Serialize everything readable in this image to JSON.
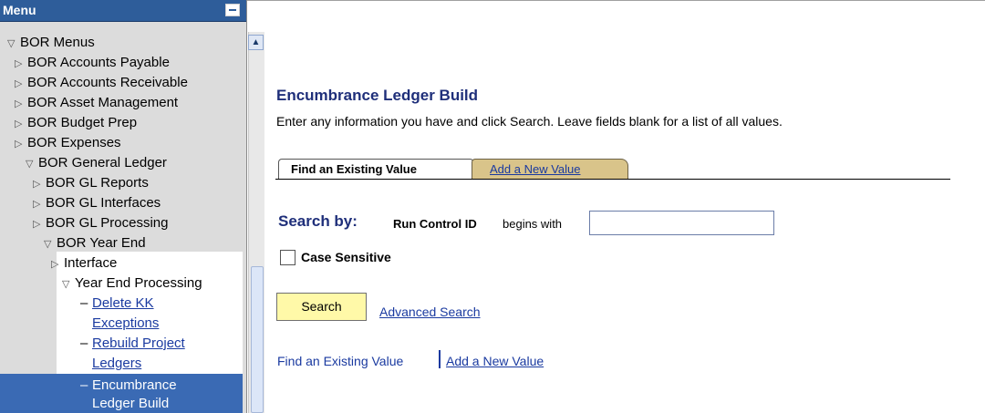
{
  "menu": {
    "title": "Menu",
    "items": [
      {
        "label": "BOR Menus",
        "state": "expanded"
      },
      {
        "label": "BOR Accounts Payable",
        "state": "collapsed"
      },
      {
        "label": "BOR Accounts Receivable",
        "state": "collapsed"
      },
      {
        "label": "BOR Asset Management",
        "state": "collapsed"
      },
      {
        "label": "BOR Budget Prep",
        "state": "collapsed"
      },
      {
        "label": "BOR Expenses",
        "state": "collapsed"
      },
      {
        "label": "BOR General Ledger",
        "state": "expanded"
      },
      {
        "label": "BOR GL Reports",
        "state": "collapsed"
      },
      {
        "label": "BOR GL Interfaces",
        "state": "collapsed"
      },
      {
        "label": "BOR GL Processing",
        "state": "collapsed"
      },
      {
        "label": "BOR Year End",
        "state": "expanded"
      },
      {
        "label": "Interface",
        "state": "collapsed"
      },
      {
        "label": "Year End Processing",
        "state": "expanded"
      },
      {
        "label": "Delete KK Exceptions",
        "lines": [
          "Delete KK",
          "Exceptions"
        ]
      },
      {
        "label": "Rebuild Project Ledgers",
        "lines": [
          "Rebuild Project",
          "Ledgers"
        ]
      },
      {
        "label": "Encumbrance Ledger Build",
        "lines": [
          "Encumbrance",
          "Ledger Build"
        ],
        "selected": true
      }
    ]
  },
  "main": {
    "title": "Encumbrance Ledger Build",
    "instructions": "Enter any information you have and click Search. Leave fields blank for a list of all values.",
    "tabs": [
      {
        "label": "Find an Existing Value",
        "active": true
      },
      {
        "label": "Add a New Value",
        "active": false
      }
    ],
    "search_by_label": "Search by:",
    "field_label": "Run Control ID",
    "operator": "begins with",
    "field_value": "",
    "case_sensitive_label": "Case Sensitive",
    "case_sensitive_checked": false,
    "search_button": "Search",
    "advanced_search": "Advanced Search",
    "bottom_links": {
      "find": "Find an Existing Value",
      "add": "Add a New Value"
    }
  },
  "colors": {
    "menu_header": "#2e5d9a",
    "menu_bg": "#dcdcdc",
    "selected": "#3a6ab4",
    "title_blue": "#1f2f7a",
    "link": "#1a3aa0",
    "search_button": "#fff9a8",
    "add_tab": "#d9c48a"
  }
}
